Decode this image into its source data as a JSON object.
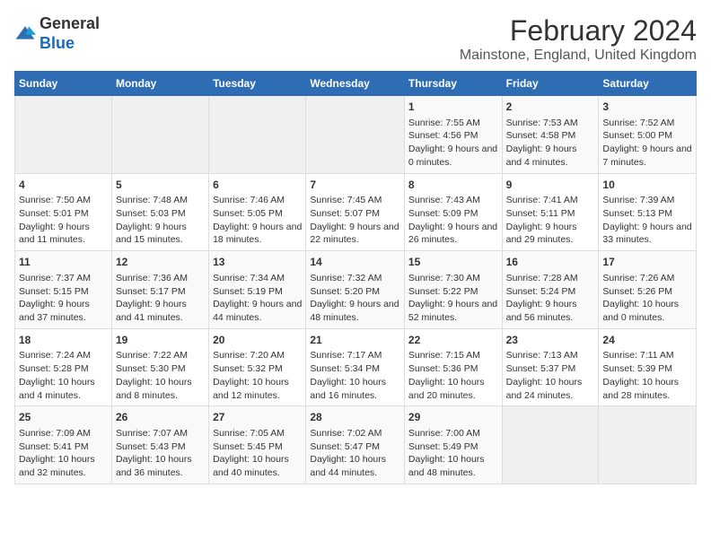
{
  "logo": {
    "general": "General",
    "blue": "Blue"
  },
  "header": {
    "title": "February 2024",
    "subtitle": "Mainstone, England, United Kingdom"
  },
  "weekdays": [
    "Sunday",
    "Monday",
    "Tuesday",
    "Wednesday",
    "Thursday",
    "Friday",
    "Saturday"
  ],
  "weeks": [
    [
      {
        "day": "",
        "info": ""
      },
      {
        "day": "",
        "info": ""
      },
      {
        "day": "",
        "info": ""
      },
      {
        "day": "",
        "info": ""
      },
      {
        "day": "1",
        "info": "Sunrise: 7:55 AM\nSunset: 4:56 PM\nDaylight: 9 hours and 0 minutes."
      },
      {
        "day": "2",
        "info": "Sunrise: 7:53 AM\nSunset: 4:58 PM\nDaylight: 9 hours and 4 minutes."
      },
      {
        "day": "3",
        "info": "Sunrise: 7:52 AM\nSunset: 5:00 PM\nDaylight: 9 hours and 7 minutes."
      }
    ],
    [
      {
        "day": "4",
        "info": "Sunrise: 7:50 AM\nSunset: 5:01 PM\nDaylight: 9 hours and 11 minutes."
      },
      {
        "day": "5",
        "info": "Sunrise: 7:48 AM\nSunset: 5:03 PM\nDaylight: 9 hours and 15 minutes."
      },
      {
        "day": "6",
        "info": "Sunrise: 7:46 AM\nSunset: 5:05 PM\nDaylight: 9 hours and 18 minutes."
      },
      {
        "day": "7",
        "info": "Sunrise: 7:45 AM\nSunset: 5:07 PM\nDaylight: 9 hours and 22 minutes."
      },
      {
        "day": "8",
        "info": "Sunrise: 7:43 AM\nSunset: 5:09 PM\nDaylight: 9 hours and 26 minutes."
      },
      {
        "day": "9",
        "info": "Sunrise: 7:41 AM\nSunset: 5:11 PM\nDaylight: 9 hours and 29 minutes."
      },
      {
        "day": "10",
        "info": "Sunrise: 7:39 AM\nSunset: 5:13 PM\nDaylight: 9 hours and 33 minutes."
      }
    ],
    [
      {
        "day": "11",
        "info": "Sunrise: 7:37 AM\nSunset: 5:15 PM\nDaylight: 9 hours and 37 minutes."
      },
      {
        "day": "12",
        "info": "Sunrise: 7:36 AM\nSunset: 5:17 PM\nDaylight: 9 hours and 41 minutes."
      },
      {
        "day": "13",
        "info": "Sunrise: 7:34 AM\nSunset: 5:19 PM\nDaylight: 9 hours and 44 minutes."
      },
      {
        "day": "14",
        "info": "Sunrise: 7:32 AM\nSunset: 5:20 PM\nDaylight: 9 hours and 48 minutes."
      },
      {
        "day": "15",
        "info": "Sunrise: 7:30 AM\nSunset: 5:22 PM\nDaylight: 9 hours and 52 minutes."
      },
      {
        "day": "16",
        "info": "Sunrise: 7:28 AM\nSunset: 5:24 PM\nDaylight: 9 hours and 56 minutes."
      },
      {
        "day": "17",
        "info": "Sunrise: 7:26 AM\nSunset: 5:26 PM\nDaylight: 10 hours and 0 minutes."
      }
    ],
    [
      {
        "day": "18",
        "info": "Sunrise: 7:24 AM\nSunset: 5:28 PM\nDaylight: 10 hours and 4 minutes."
      },
      {
        "day": "19",
        "info": "Sunrise: 7:22 AM\nSunset: 5:30 PM\nDaylight: 10 hours and 8 minutes."
      },
      {
        "day": "20",
        "info": "Sunrise: 7:20 AM\nSunset: 5:32 PM\nDaylight: 10 hours and 12 minutes."
      },
      {
        "day": "21",
        "info": "Sunrise: 7:17 AM\nSunset: 5:34 PM\nDaylight: 10 hours and 16 minutes."
      },
      {
        "day": "22",
        "info": "Sunrise: 7:15 AM\nSunset: 5:36 PM\nDaylight: 10 hours and 20 minutes."
      },
      {
        "day": "23",
        "info": "Sunrise: 7:13 AM\nSunset: 5:37 PM\nDaylight: 10 hours and 24 minutes."
      },
      {
        "day": "24",
        "info": "Sunrise: 7:11 AM\nSunset: 5:39 PM\nDaylight: 10 hours and 28 minutes."
      }
    ],
    [
      {
        "day": "25",
        "info": "Sunrise: 7:09 AM\nSunset: 5:41 PM\nDaylight: 10 hours and 32 minutes."
      },
      {
        "day": "26",
        "info": "Sunrise: 7:07 AM\nSunset: 5:43 PM\nDaylight: 10 hours and 36 minutes."
      },
      {
        "day": "27",
        "info": "Sunrise: 7:05 AM\nSunset: 5:45 PM\nDaylight: 10 hours and 40 minutes."
      },
      {
        "day": "28",
        "info": "Sunrise: 7:02 AM\nSunset: 5:47 PM\nDaylight: 10 hours and 44 minutes."
      },
      {
        "day": "29",
        "info": "Sunrise: 7:00 AM\nSunset: 5:49 PM\nDaylight: 10 hours and 48 minutes."
      },
      {
        "day": "",
        "info": ""
      },
      {
        "day": "",
        "info": ""
      }
    ]
  ]
}
